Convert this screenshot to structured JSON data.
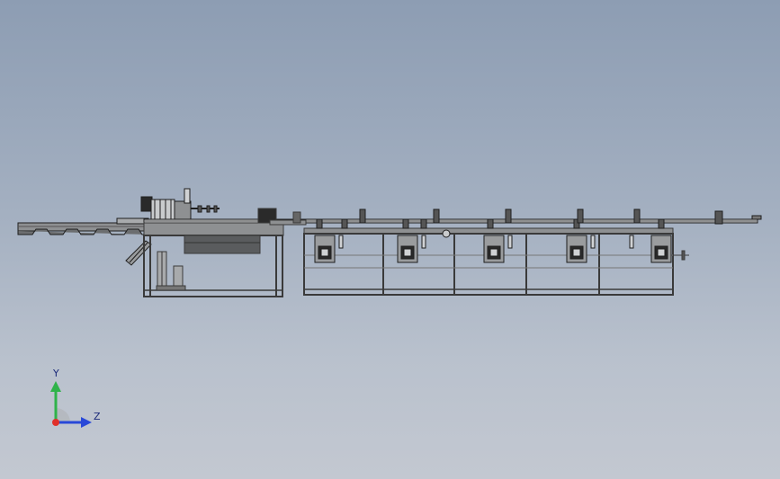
{
  "viewport": {
    "background_top": "#8d9db3",
    "background_bottom": "#c3c8d1"
  },
  "model": {
    "line_color": "#1e1e1e",
    "frame_color": "#3a3a3a",
    "body_fill": "#8e9092",
    "dark_fill": "#2a2a2a",
    "highlight_fill": "#d0d2d4",
    "station_count": 5
  },
  "triad": {
    "y_label": "Y",
    "z_label": "Z",
    "y_color": "#2fb34a",
    "z_color": "#2848d8",
    "x_color": "#e0302a"
  }
}
